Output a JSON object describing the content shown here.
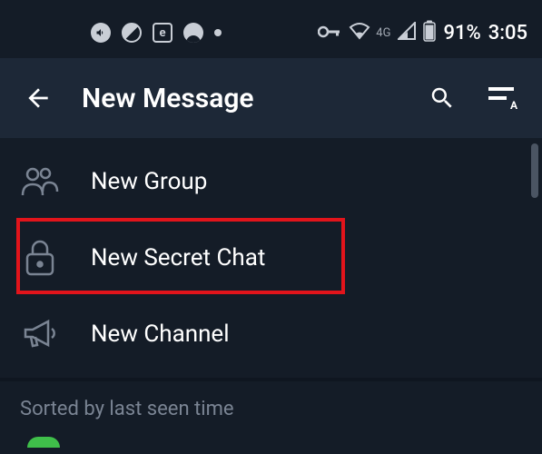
{
  "status": {
    "e_label": "e",
    "network": "4G",
    "battery": "91%",
    "time": "3:05"
  },
  "header": {
    "title": "New Message"
  },
  "menu": {
    "items": [
      {
        "label": "New Group"
      },
      {
        "label": "New Secret Chat"
      },
      {
        "label": "New Channel"
      }
    ]
  },
  "sort": {
    "label": "Sorted by last seen time"
  }
}
